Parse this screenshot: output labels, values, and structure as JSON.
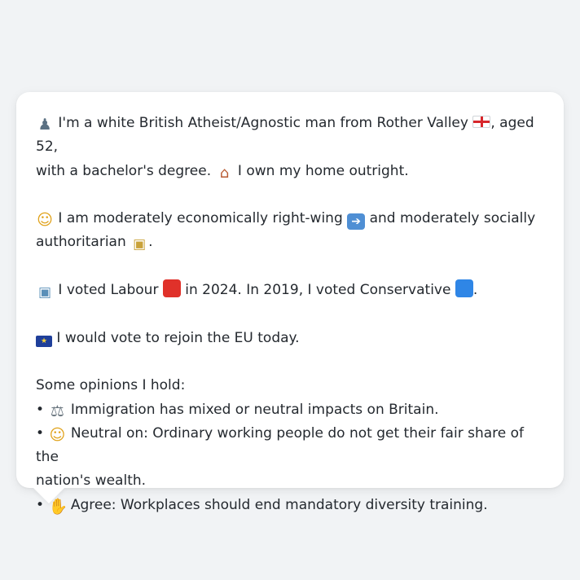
{
  "intro": {
    "icon": "person-silhouette-icon",
    "text_before_flag": "I'm a white British Atheist/Agnostic man from Rother Valley",
    "flag_icon": "england-flag-icon",
    "text_after_flag": ", aged 52,",
    "line2": "with a bachelor's degree.",
    "house_icon": "house-icon",
    "line2_after": "I own my home outright."
  },
  "politics": {
    "icon": "thinking-face-icon",
    "text1": "I am moderately economically right-wing",
    "arrow_icon": "right-arrow-icon",
    "text2": "and moderately socially",
    "text3": "authoritarian",
    "lock_icon": "lock-icon",
    "text3_after": "."
  },
  "voting": {
    "icon": "ballot-box-icon",
    "text1": "I voted Labour",
    "labour_icon": "red-square-icon",
    "text2": "in 2024. In 2019, I voted Conservative",
    "conservative_icon": "blue-square-icon",
    "text3": "."
  },
  "eu": {
    "icon": "eu-flag-icon",
    "text": "I would vote to rejoin the EU today."
  },
  "opinions": {
    "heading": "Some opinions I hold:",
    "items": [
      {
        "bullet": "•",
        "icon": "balance-scale-icon",
        "glyph": "⚖",
        "text": "Immigration has mixed or neutral impacts on Britain."
      },
      {
        "bullet": "•",
        "icon": "neutral-face-icon",
        "glyph": "☺",
        "text": "Neutral on: Ordinary working people do not get their fair share of the",
        "text_cont": "nation's wealth."
      },
      {
        "bullet": "•",
        "icon": "thumbs-up-icon",
        "glyph": "✋",
        "text": "Agree: Workplaces should end mandatory diversity training."
      }
    ]
  },
  "colors": {
    "background": "#f1f3f5",
    "bubble": "#ffffff",
    "text": "#24292f",
    "labour_red": "#e0312a",
    "conservative_blue": "#2f86e6"
  }
}
